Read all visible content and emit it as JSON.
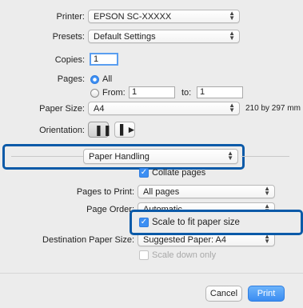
{
  "printer": {
    "label": "Printer:",
    "value": "EPSON SC-XXXXX"
  },
  "presets": {
    "label": "Presets:",
    "value": "Default Settings"
  },
  "copies": {
    "label": "Copies:",
    "value": "1"
  },
  "pages": {
    "label": "Pages:",
    "all_label": "All",
    "from_label": "From:",
    "from_value": "1",
    "to_label": "to:",
    "to_value": "1"
  },
  "paper_size": {
    "label": "Paper Size:",
    "value": "A4",
    "dims": "210 by 297 mm"
  },
  "orientation": {
    "label": "Orientation:"
  },
  "section_menu": {
    "value": "Paper Handling"
  },
  "collate": {
    "label": "Collate pages",
    "checked": true
  },
  "pages_to_print": {
    "label": "Pages to Print:",
    "value": "All pages"
  },
  "page_order": {
    "label": "Page Order:",
    "value": "Automatic"
  },
  "scale_fit": {
    "label": "Scale to fit paper size",
    "checked": true
  },
  "destination": {
    "label": "Destination Paper Size:",
    "value": "Suggested Paper: A4"
  },
  "scale_down": {
    "label": "Scale down only",
    "checked": false
  },
  "buttons": {
    "cancel": "Cancel",
    "print": "Print"
  },
  "colors": {
    "accent": "#3a8cf2",
    "callout_border": "#0b5aa8"
  }
}
